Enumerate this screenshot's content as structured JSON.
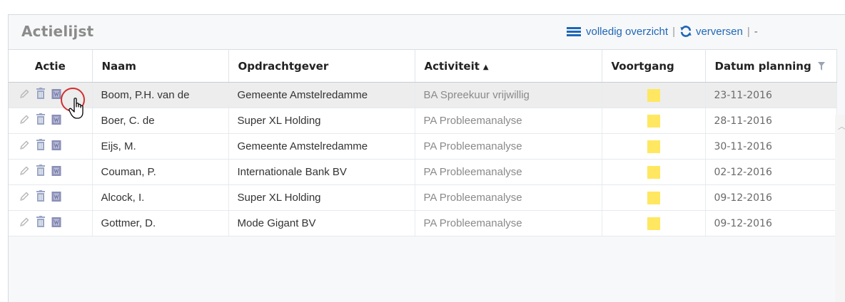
{
  "panel": {
    "title": "Actielijst",
    "toolbar": {
      "overview_label": "volledig overzicht",
      "separator": "|",
      "refresh_label": "verversen",
      "trailing": "-"
    }
  },
  "table": {
    "columns": {
      "actie": "Actie",
      "naam": "Naam",
      "opdrachtgever": "Opdrachtgever",
      "activiteit": "Activiteit",
      "voortgang": "Voortgang",
      "datum": "Datum planning"
    },
    "sort": {
      "column": "Activiteit",
      "direction": "ascending"
    },
    "rows": [
      {
        "naam": "Boom, P.H. van de",
        "opdrachtgever": "Gemeente Amstelredamme",
        "activiteit": "BA Spreekuur vrijwillig",
        "datum": "23-11-2016",
        "progress_color": "#ffe761",
        "selected": true
      },
      {
        "naam": "Boer, C. de",
        "opdrachtgever": "Super XL Holding",
        "activiteit": "PA Probleemanalyse",
        "datum": "28-11-2016",
        "progress_color": "#ffe761"
      },
      {
        "naam": "Eijs, M.",
        "opdrachtgever": "Gemeente Amstelredamme",
        "activiteit": "PA Probleemanalyse",
        "datum": "30-11-2016",
        "progress_color": "#ffe761"
      },
      {
        "naam": "Couman, P.",
        "opdrachtgever": "Internationale Bank BV",
        "activiteit": "PA Probleemanalyse",
        "datum": "02-12-2016",
        "progress_color": "#ffe761"
      },
      {
        "naam": "Alcock, I.",
        "opdrachtgever": "Super XL Holding",
        "activiteit": "PA Probleemanalyse",
        "datum": "09-12-2016",
        "progress_color": "#ffe761"
      },
      {
        "naam": "Gottmer, D.",
        "opdrachtgever": "Mode Gigant BV",
        "activiteit": "PA Probleemanalyse",
        "datum": "09-12-2016",
        "progress_color": "#ffe761"
      }
    ],
    "row_action_icons": [
      "pencil-icon",
      "trash-icon",
      "document-icon"
    ]
  },
  "colors": {
    "link": "#1e67b8",
    "progress": "#ffe761",
    "highlight": "#d32f2f",
    "selected_row": "#ededed"
  }
}
